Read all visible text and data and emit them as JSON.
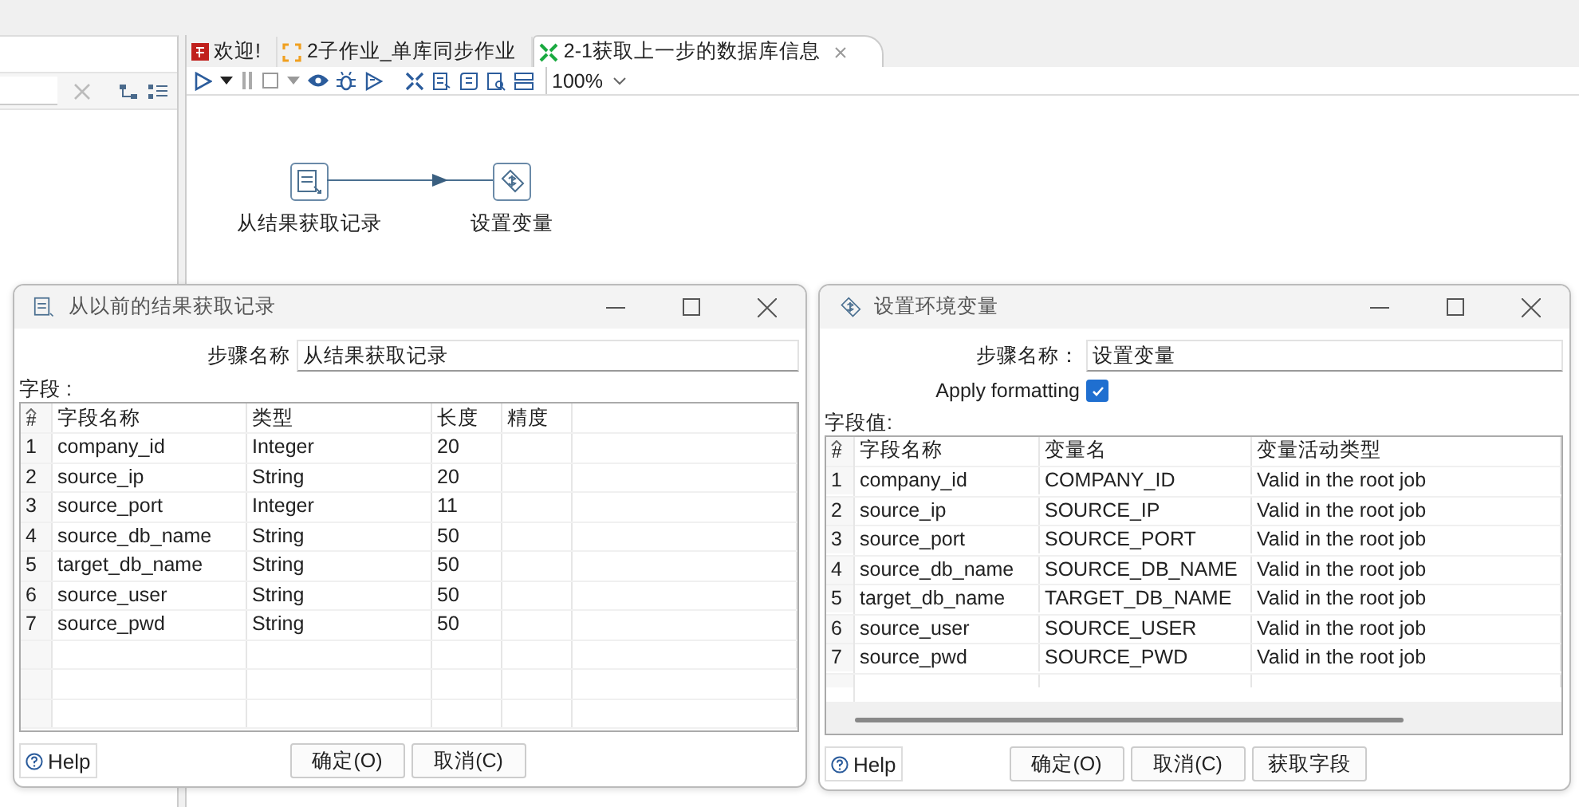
{
  "tabs": [
    {
      "label": "欢迎!",
      "selected": false,
      "kind": "welcome"
    },
    {
      "label": "2子作业_单库同步作业",
      "selected": false,
      "kind": "job"
    },
    {
      "label": "2-1获取上一步的数据库信息",
      "selected": true,
      "kind": "transform"
    }
  ],
  "toolbar": {
    "zoom": "100%"
  },
  "canvas": {
    "steps": [
      {
        "label": "从结果获取记录",
        "kind": "get-rows"
      },
      {
        "label": "设置变量",
        "kind": "set-vars"
      }
    ]
  },
  "dialogs": [
    {
      "kind": "get-rows",
      "title": "从以前的结果获取记录",
      "step_name_label": "步骤名称",
      "step_name": "从结果获取记录",
      "fields_label": "字段 :",
      "columns": [
        "#",
        "字段名称",
        "类型",
        "长度",
        "精度"
      ],
      "rows": [
        [
          "1",
          "company_id",
          "Integer",
          "20",
          ""
        ],
        [
          "2",
          "source_ip",
          "String",
          "20",
          ""
        ],
        [
          "3",
          "source_port",
          "Integer",
          "11",
          ""
        ],
        [
          "4",
          "source_db_name",
          "String",
          "50",
          ""
        ],
        [
          "5",
          "target_db_name",
          "String",
          "50",
          ""
        ],
        [
          "6",
          "source_user",
          "String",
          "50",
          ""
        ],
        [
          "7",
          "source_pwd",
          "String",
          "50",
          ""
        ]
      ],
      "help": "Help",
      "buttons": [
        "确定(O)",
        "取消(C)"
      ]
    },
    {
      "kind": "set-vars",
      "title": "设置环境变量",
      "step_name_label": "步骤名称：",
      "step_name": "设置变量",
      "apply_formatting": {
        "label": "Apply formatting",
        "checked": true
      },
      "fields_label": "字段值:",
      "columns": [
        "#",
        "字段名称",
        "变量名",
        "变量活动类型"
      ],
      "rows": [
        [
          "1",
          "company_id",
          "COMPANY_ID",
          "Valid in the root job"
        ],
        [
          "2",
          "source_ip",
          "SOURCE_IP",
          "Valid in the root job"
        ],
        [
          "3",
          "source_port",
          "SOURCE_PORT",
          "Valid in the root job"
        ],
        [
          "4",
          "source_db_name",
          "SOURCE_DB_NAME",
          "Valid in the root job"
        ],
        [
          "5",
          "target_db_name",
          "TARGET_DB_NAME",
          "Valid in the root job"
        ],
        [
          "6",
          "source_user",
          "SOURCE_USER",
          "Valid in the root job"
        ],
        [
          "7",
          "source_pwd",
          "SOURCE_PWD",
          "Valid in the root job"
        ]
      ],
      "help": "Help",
      "buttons": [
        "确定(O)",
        "取消(C)",
        "获取字段"
      ]
    }
  ]
}
